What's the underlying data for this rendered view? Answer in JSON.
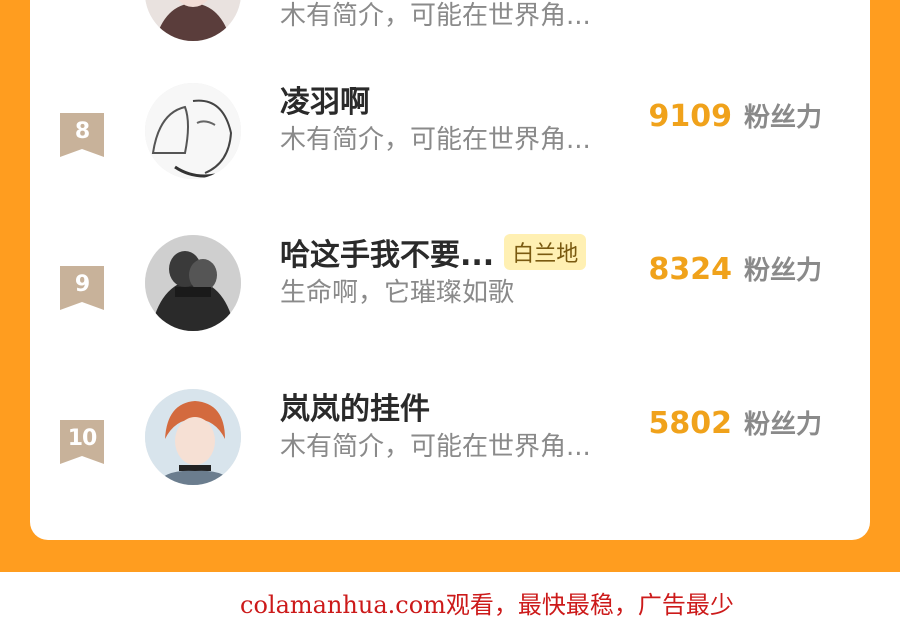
{
  "ranking": {
    "rows": [
      {
        "rank": "",
        "name": "",
        "badge": "",
        "bio": "木有简介，可能在世界角...",
        "score": "",
        "unit": ""
      },
      {
        "rank": "8",
        "name": "凌羽啊",
        "badge": "",
        "bio": "木有简介，可能在世界角...",
        "score": "9109",
        "unit": "粉丝力"
      },
      {
        "rank": "9",
        "name": "哈这手我不要...",
        "badge": "白兰地",
        "bio": "生命啊，它璀璨如歌",
        "score": "8324",
        "unit": "粉丝力"
      },
      {
        "rank": "10",
        "name": "岚岚的挂件",
        "badge": "",
        "bio": "木有简介，可能在世界角...",
        "score": "5802",
        "unit": "粉丝力"
      }
    ]
  },
  "footer": {
    "ad_text": "colamanhua.com观看，最快最稳，广告最少"
  },
  "colors": {
    "background_orange": "#ff9d1f",
    "score_gold": "#f0a21b",
    "rank_tag": "#c8b29a",
    "badge_bg": "#fff0b3",
    "ad_red": "#cc1a1a"
  },
  "icons": {
    "rank_tag": "bookmark-ribbon-icon"
  }
}
